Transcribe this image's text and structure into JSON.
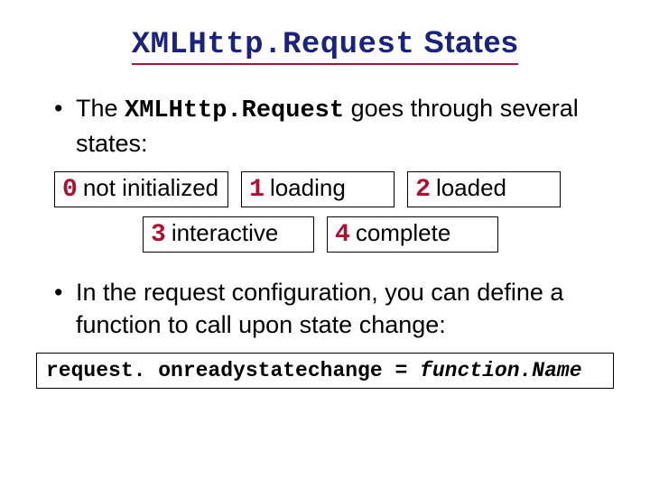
{
  "title": {
    "part1_mono": "XMLHttp.Request",
    "part2": " States"
  },
  "bullet1": {
    "pre": "The ",
    "mono": "XMLHttp.Request",
    "post": " goes through several states:"
  },
  "states": [
    {
      "num": "0",
      "label": " not initialized"
    },
    {
      "num": "1",
      "label": " loading"
    },
    {
      "num": "2",
      "label": " loaded"
    },
    {
      "num": "3",
      "label": " interactive"
    },
    {
      "num": "4",
      "label": " complete"
    }
  ],
  "bullet2": "In the request configuration, you can define a function to call upon state change:",
  "code": {
    "lhs": "request. onreadystatechange = ",
    "fn": "function.Name"
  }
}
